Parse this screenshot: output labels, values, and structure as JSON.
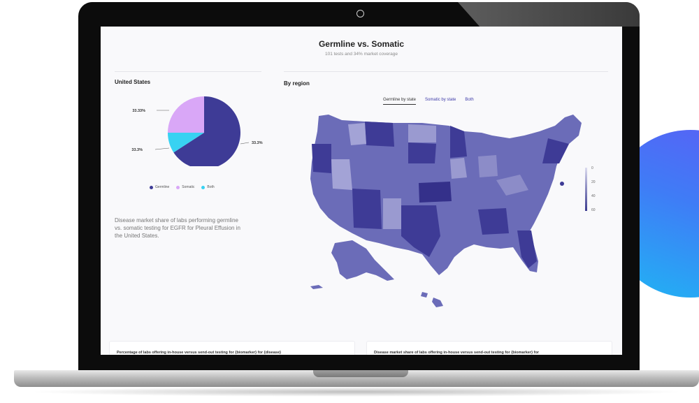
{
  "header": {
    "title": "Germline vs. Somatic",
    "subtitle": "101 tests and 34% market coverage"
  },
  "us_section": {
    "title": "United States",
    "description": "Disease market share of labs performing germline vs. somatic testing for EGFR for Pleural Effusion in the United States."
  },
  "chart_data": {
    "type": "pie",
    "categories": [
      "Germline",
      "Somatic",
      "Both"
    ],
    "values": [
      33.3,
      33.33,
      33.3
    ],
    "value_labels": [
      "33.3%",
      "33.33%",
      "33.3%"
    ],
    "colors": [
      "#3e3b96",
      "#d9a7f7",
      "#38d2f2"
    ],
    "legend": [
      "Germline",
      "Somatic",
      "Both"
    ],
    "legend_position": "bottom"
  },
  "region_section": {
    "title": "By region",
    "tabs": [
      "Germline by state",
      "Somatic by state",
      "Both"
    ],
    "active_tab": "Germline by state",
    "scale_labels": [
      "0",
      "20",
      "40",
      "60"
    ],
    "scale_colors": [
      "#dcdcef",
      "#3b3b8f"
    ]
  },
  "cards": [
    "Percentage of labs offering in-house versus send-out testing for {biomarker} for {disease}",
    "Disease market share of labs offering in-house versus send-out testing for {biomarker} for"
  ]
}
